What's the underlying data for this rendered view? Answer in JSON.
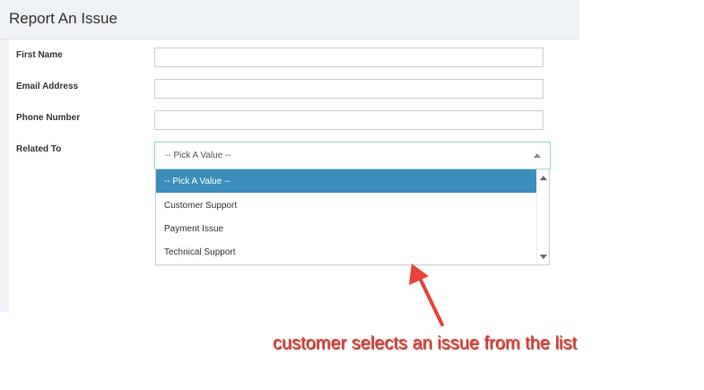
{
  "panel": {
    "title": "Report An Issue"
  },
  "form": {
    "first_name_label": "First Name",
    "first_name_value": "",
    "email_label": "Email Address",
    "email_value": "",
    "phone_label": "Phone Number",
    "phone_value": "",
    "related_label": "Related To",
    "related_selected": "-- Pick A Value --",
    "related_options": [
      "-- Pick A Value --",
      "Customer Support",
      "Payment Issue",
      "Technical Support"
    ]
  },
  "annotation": {
    "text": "customer selects an issue from the list",
    "color": "#e8423a"
  },
  "colors": {
    "header_bg": "#eef1f5",
    "selected_option_bg": "#3c8dbc"
  }
}
